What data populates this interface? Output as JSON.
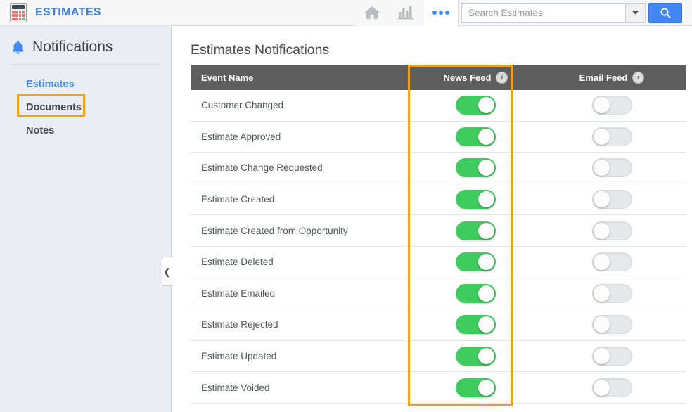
{
  "topbar": {
    "app_icon": "calculator-icon",
    "app_title": "ESTIMATES",
    "home_icon": "home-icon",
    "reports_icon": "bar-chart-icon",
    "more_icon": "more-ellipsis-icon",
    "search": {
      "placeholder": "Search Estimates",
      "value": "",
      "dropdown_icon": "chevron-down-icon",
      "search_button_icon": "search-icon"
    }
  },
  "sidebar": {
    "bell_icon": "bell-icon",
    "heading": "Notifications",
    "items": [
      {
        "label": "Estimates",
        "active": true
      },
      {
        "label": "Documents",
        "active": false
      },
      {
        "label": "Notes",
        "active": false
      }
    ],
    "collapse_icon": "chevron-left-icon"
  },
  "main": {
    "page_title": "Estimates Notifications",
    "table": {
      "columns": [
        {
          "label": "Event Name",
          "info_icon": false
        },
        {
          "label": "News Feed",
          "info_icon": true
        },
        {
          "label": "Email Feed",
          "info_icon": true
        }
      ],
      "rows": [
        {
          "event": "Customer Changed",
          "news_feed": "on",
          "email_feed": "off"
        },
        {
          "event": "Estimate Approved",
          "news_feed": "on",
          "email_feed": "off"
        },
        {
          "event": "Estimate Change Requested",
          "news_feed": "on",
          "email_feed": "off"
        },
        {
          "event": "Estimate Created",
          "news_feed": "on",
          "email_feed": "off"
        },
        {
          "event": "Estimate Created from Opportunity",
          "news_feed": "on",
          "email_feed": "off"
        },
        {
          "event": "Estimate Deleted",
          "news_feed": "on",
          "email_feed": "off"
        },
        {
          "event": "Estimate Emailed",
          "news_feed": "on",
          "email_feed": "off"
        },
        {
          "event": "Estimate Rejected",
          "news_feed": "on",
          "email_feed": "off"
        },
        {
          "event": "Estimate Updated",
          "news_feed": "on",
          "email_feed": "off"
        },
        {
          "event": "Estimate Voided",
          "news_feed": "on",
          "email_feed": "off"
        }
      ]
    }
  },
  "highlights": [
    {
      "name": "sidebar-estimates-highlight",
      "color": "#f5a010"
    },
    {
      "name": "news-feed-column-highlight",
      "color": "#f5a010"
    }
  ],
  "colors": {
    "accent_blue": "#3d8bf2",
    "toggle_on_green": "#3fcc5f",
    "toggle_off_gray": "#e6e8ea",
    "header_gray": "#5e5e5e",
    "highlight_orange": "#f5a010",
    "sidebar_bg": "#eaeef2"
  }
}
